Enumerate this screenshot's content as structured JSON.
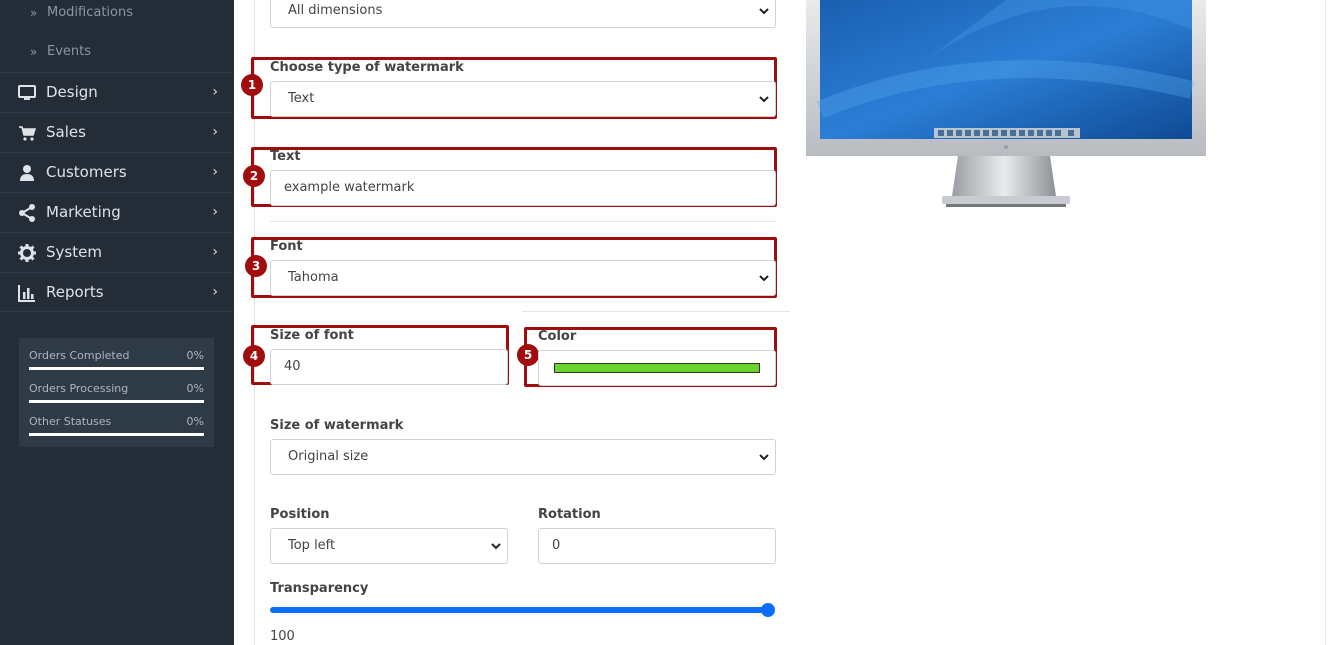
{
  "sidebar": {
    "sub_items": [
      {
        "label": "Modifications"
      },
      {
        "label": "Events"
      }
    ],
    "menu": [
      {
        "label": "Design",
        "icon": "monitor-icon"
      },
      {
        "label": "Sales",
        "icon": "cart-icon"
      },
      {
        "label": "Customers",
        "icon": "user-icon"
      },
      {
        "label": "Marketing",
        "icon": "share-icon"
      },
      {
        "label": "System",
        "icon": "gear-icon"
      },
      {
        "label": "Reports",
        "icon": "bar-chart-icon"
      }
    ],
    "stats": [
      {
        "label": "Orders Completed",
        "value": "0%"
      },
      {
        "label": "Orders Processing",
        "value": "0%"
      },
      {
        "label": "Other Statuses",
        "value": "0%"
      }
    ]
  },
  "form": {
    "dimensions": {
      "value": "All dimensions"
    },
    "watermark_type": {
      "label": "Choose type of watermark",
      "value": "Text",
      "badge": "1"
    },
    "text": {
      "label": "Text",
      "value": "example watermark",
      "badge": "2"
    },
    "font": {
      "label": "Font",
      "value": "Tahoma",
      "badge": "3"
    },
    "font_size": {
      "label": "Size of font",
      "value": "40",
      "badge": "4"
    },
    "color": {
      "label": "Color",
      "value": "#69d52c",
      "badge": "5"
    },
    "watermark_size": {
      "label": "Size of watermark",
      "value": "Original size"
    },
    "position": {
      "label": "Position",
      "value": "Top left"
    },
    "rotation": {
      "label": "Rotation",
      "value": "0"
    },
    "transparency": {
      "label": "Transparency",
      "value": "100"
    }
  },
  "colors": {
    "sidebar_bg": "#242d37",
    "highlight": "#a10d0d",
    "slider": "#0d6efd",
    "swatch": "#69d52c"
  }
}
